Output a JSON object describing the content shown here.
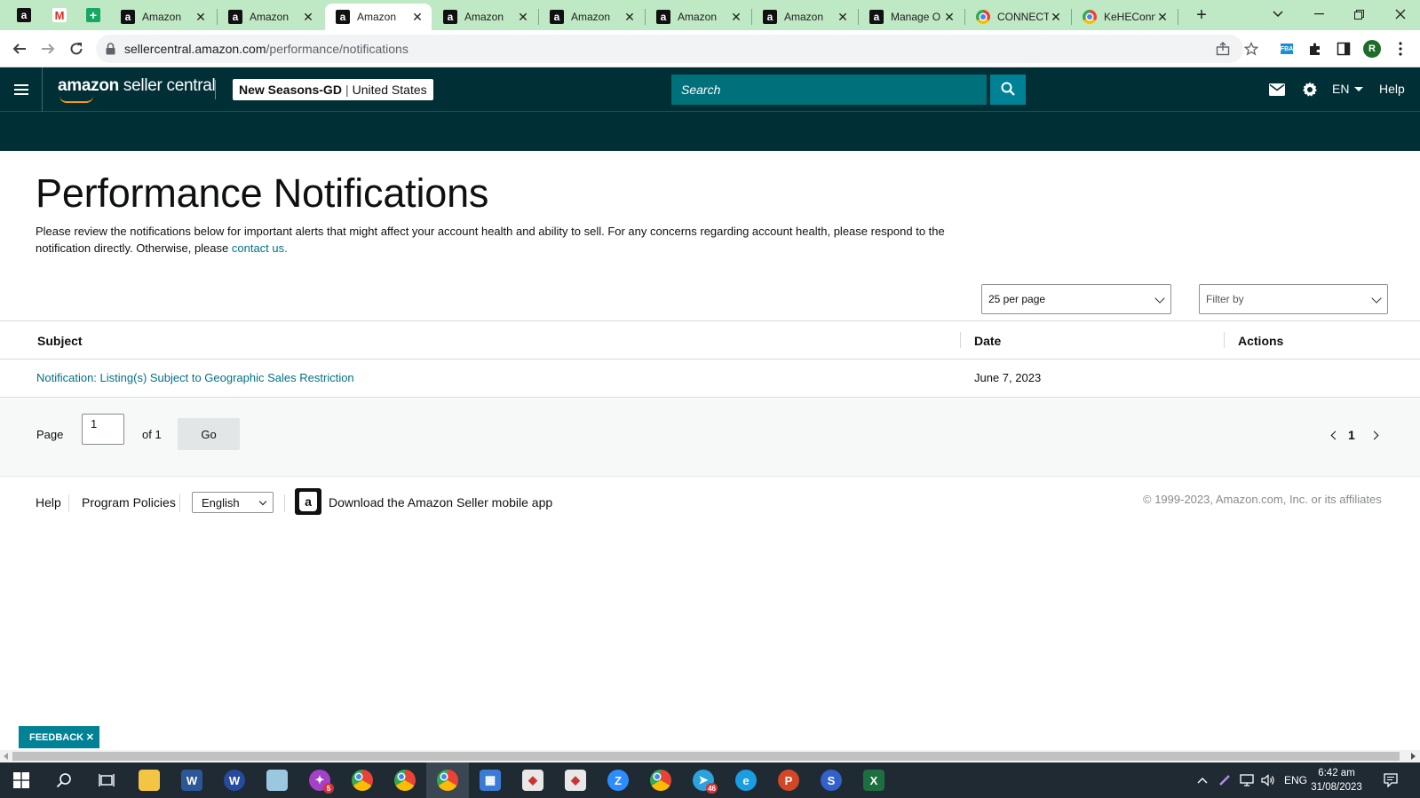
{
  "browser": {
    "tabs": [
      {
        "title": "Amazon",
        "icon": "amazon-icon",
        "active": false
      },
      {
        "title": "Amazon",
        "icon": "amazon-icon",
        "active": false
      },
      {
        "title": "Amazon",
        "icon": "amazon-icon",
        "active": true
      },
      {
        "title": "Amazon",
        "icon": "amazon-icon",
        "active": false
      },
      {
        "title": "Amazon",
        "icon": "amazon-icon",
        "active": false
      },
      {
        "title": "Amazon",
        "icon": "amazon-icon",
        "active": false
      },
      {
        "title": "Amazon",
        "icon": "amazon-icon",
        "active": false
      },
      {
        "title": "Manage O",
        "icon": "amazon-icon",
        "active": false
      },
      {
        "title": "CONNECT",
        "icon": "chrome-icon",
        "active": false
      },
      {
        "title": "KeHEConn",
        "icon": "chrome-icon",
        "active": false
      }
    ],
    "url_host": "sellercentral.amazon.com",
    "url_path": "/performance/notifications",
    "profile_initial": "R",
    "fba_label": "FBA"
  },
  "header": {
    "logo_brand": "amazon",
    "logo_suffix": " seller central",
    "store_name": "New Seasons-GD",
    "store_separator": "|",
    "marketplace": "United States",
    "search_placeholder": "Search",
    "language": "EN",
    "help_label": "Help"
  },
  "page": {
    "title": "Performance Notifications",
    "intro_text": "Please review the notifications below for important alerts that might affect your account health and ability to sell. For any concerns regarding account health, please respond to the notification directly. Otherwise, please ",
    "contact_link": "contact us.",
    "per_page": "25 per page",
    "filter_placeholder": "Filter by"
  },
  "table": {
    "columns": [
      "Subject",
      "Date",
      "Actions"
    ],
    "rows": [
      {
        "subject": "Notification: Listing(s) Subject to Geographic Sales Restriction",
        "date": "June 7, 2023",
        "actions": ""
      }
    ]
  },
  "pagination": {
    "page_label": "Page",
    "page_value": "1",
    "of_label": "of 1",
    "go_label": "Go",
    "current_page": "1"
  },
  "footer": {
    "help": "Help",
    "program_policies": "Program Policies",
    "language_selected": "English",
    "app_download": "Download the Amazon Seller mobile app",
    "copyright": "© 1999-2023, Amazon.com, Inc. or its affiliates"
  },
  "feedback": {
    "label": "FEEDBACK",
    "close": "✕"
  },
  "taskbar": {
    "language": "ENG",
    "time": "6:42 am",
    "date": "31/08/2023",
    "badges": {
      "messenger": "5",
      "telegram": "46"
    }
  },
  "colors": {
    "header_bg": "#002f36",
    "search_bg": "#00707a",
    "accent_teal": "#008296",
    "link": "#007185",
    "tabstrip_bg": "#bfe8c4"
  }
}
